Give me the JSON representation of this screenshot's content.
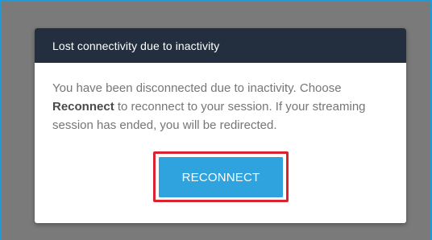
{
  "dialog": {
    "title": "Lost connectivity due to inactivity",
    "message_part1": "You have been disconnected due to inactivity. Choose ",
    "message_emphasis": "Reconnect",
    "message_part2": " to reconnect to your session. If your streaming session has ended, you will be redirected.",
    "button_label": "RECONNECT"
  },
  "colors": {
    "header_bg": "#232f3e",
    "button_bg": "#2ea3de",
    "highlight_border": "#d9232e",
    "frame_border": "#1f9ad6"
  }
}
